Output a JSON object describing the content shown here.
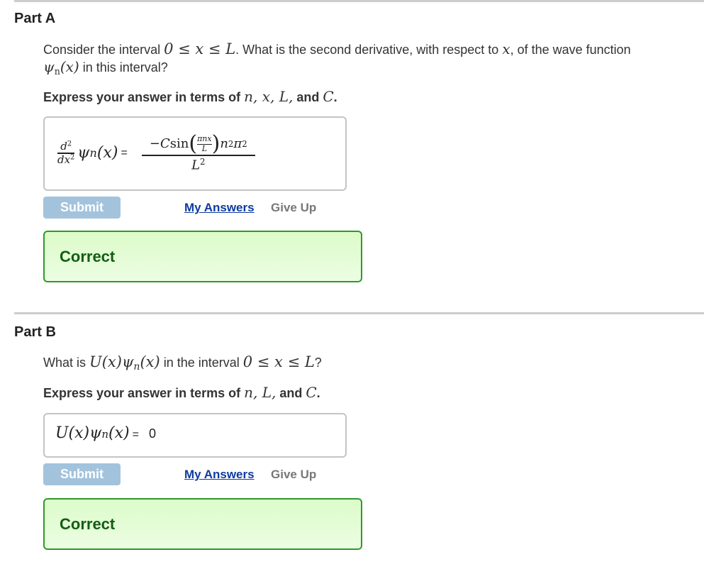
{
  "parts": [
    {
      "title": "Part A",
      "prompt": {
        "text_1": "Consider the interval ",
        "math_interval": "0 ≤ x ≤ L",
        "text_2": ". What is the second derivative, with respect to ",
        "math_x": "x",
        "text_3": ", of the wave function",
        "psi": "ψ",
        "psi_sub": "n",
        "psi_arg": "(x)",
        "text_4": " in this interval?"
      },
      "instruction": {
        "text_1": "Express your answer in terms of ",
        "vars": "n, x, L,",
        "text_2": " and ",
        "last_var": "C",
        "text_3": "."
      },
      "answer": {
        "lhs_num": "d",
        "lhs_num_sup": "2",
        "lhs_den": "dx",
        "lhs_den_sup": "2",
        "lhs_psi": "ψ",
        "lhs_psi_sub": "n",
        "lhs_arg": "(x)",
        "equals": "=",
        "rhs_num_prefix": "−C",
        "rhs_sin": "sin",
        "rhs_inner_num": "πnx",
        "rhs_inner_den": "L",
        "rhs_num_suffix_n": "n",
        "rhs_num_suffix_n_sup": "2",
        "rhs_num_suffix_pi": "π",
        "rhs_num_suffix_pi_sup": "2",
        "rhs_den": "L",
        "rhs_den_sup": "2"
      },
      "submit_label": "Submit",
      "my_answers_label": "My Answers",
      "give_up_label": "Give Up",
      "feedback": "Correct"
    },
    {
      "title": "Part B",
      "prompt": {
        "text_1": "What is ",
        "math_expr": "U(x)ψ",
        "psi_sub": "n",
        "math_arg": "(x)",
        "text_2": " in the interval ",
        "math_interval": "0 ≤ x ≤ L",
        "text_3": "?"
      },
      "instruction": {
        "text_1": "Express your answer in terms of ",
        "vars": "n, L,",
        "text_2": " and ",
        "last_var": "C",
        "text_3": "."
      },
      "answer": {
        "lhs": "U(x)ψ",
        "lhs_sub": "n",
        "lhs_arg": "(x)",
        "equals": "=",
        "value": "0"
      },
      "submit_label": "Submit",
      "my_answers_label": "My Answers",
      "give_up_label": "Give Up",
      "feedback": "Correct"
    }
  ],
  "colors": {
    "submit_disabled": "#a3c3dd",
    "link_blue": "#0d3b9e",
    "give_up_gray": "#777777",
    "correct_border": "#2f9a2a",
    "correct_text": "#125e14",
    "correct_bg": "#dcfcc9"
  }
}
